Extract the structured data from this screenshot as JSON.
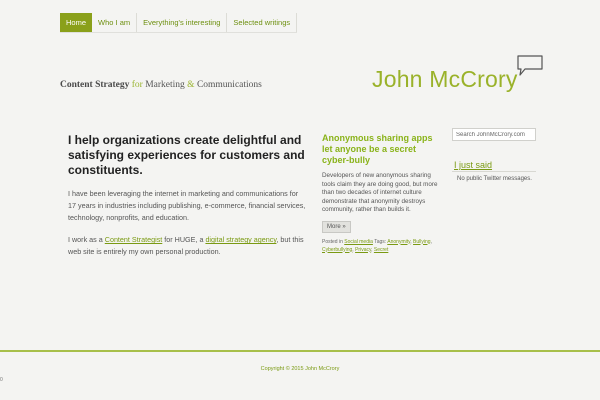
{
  "nav": {
    "items": [
      {
        "label": "Home",
        "active": true
      },
      {
        "label": "Who I am",
        "active": false
      },
      {
        "label": "Everything's interesting",
        "active": false
      },
      {
        "label": "Selected writings",
        "active": false
      }
    ]
  },
  "header": {
    "tagline": {
      "part1": "Content Strategy",
      "part2": " for ",
      "part3": "Marketing",
      "part4": " & ",
      "part5": "Communications"
    },
    "logo": "John McCrory"
  },
  "hero": {
    "heading": "I help organizations create delightful and satisfying experiences for customers and constituents.",
    "paragraph1": "I have been leveraging the internet in marketing and communications for 17 years in industries including publishing, e-commerce, financial services, technology, nonprofits, and education.",
    "p2_pre": "I work as a ",
    "p2_link1": "Content Strategist",
    "p2_mid": " for HUGE, a ",
    "p2_link2": "digital strategy agency",
    "p2_post": ", but this web site is entirely my own personal production."
  },
  "post": {
    "title": "Anonymous sharing apps let anyone be a secret cyber-bully",
    "excerpt": "Developers of new anonymous sharing tools claim they are doing good, but more than two decades of internet culture demonstrate that anonymity destroys community, rather than builds it.",
    "more_label": "More »",
    "meta_posted_in": "Posted in",
    "meta_category": "Social media",
    "meta_tags_label": "Tags:",
    "meta_tag1": "Anonymity",
    "meta_tag2": "Bullying",
    "meta_tag3": "Cyberbullying",
    "meta_tag4": "Privacy",
    "meta_tag5": "Secret"
  },
  "sidebar": {
    "search_placeholder": "Search JohnMcCrory.com",
    "heading": "I just said",
    "twitter_text": "No public Twitter messages."
  },
  "footer": {
    "copyright": "Copyright © 2015 John McCrory",
    "tiny_mark": "0"
  },
  "colors": {
    "accent": "#8aa01a",
    "logo": "#9ab22a",
    "background": "#f4f4f2"
  }
}
